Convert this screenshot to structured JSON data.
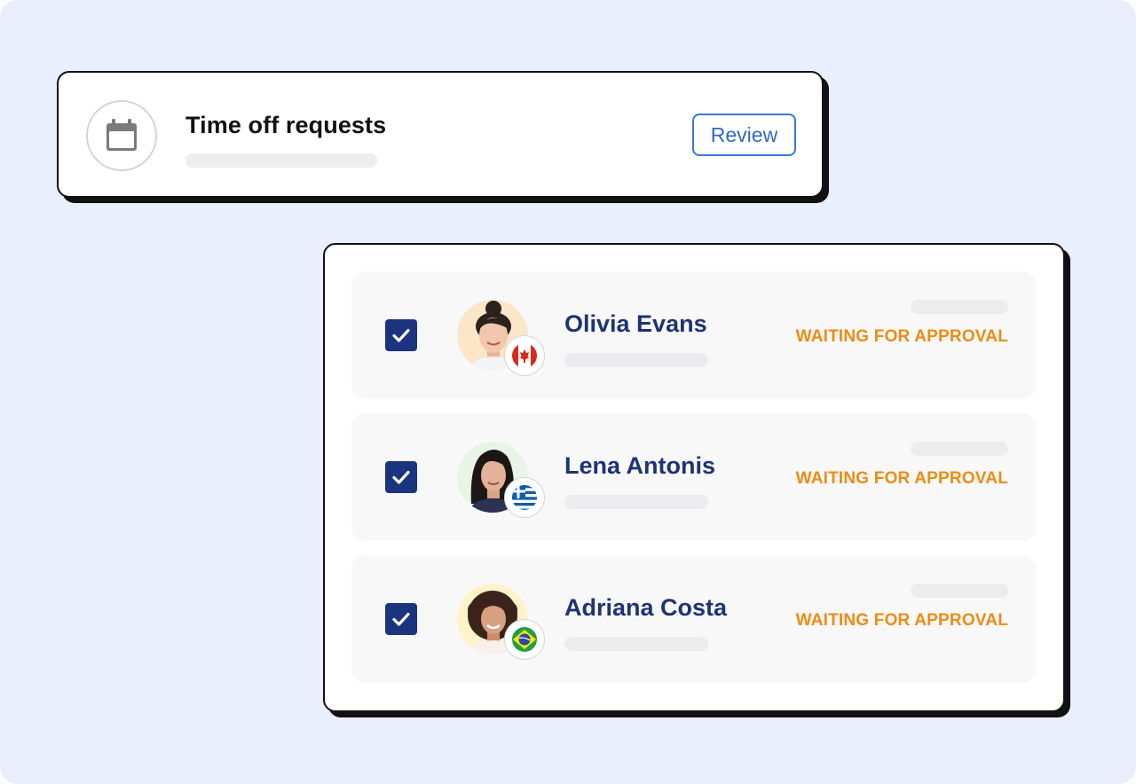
{
  "colors": {
    "background": "#e9effc",
    "accent_blue": "#3d76d6",
    "checkbox": "#1b3480",
    "name_text": "#1d3373",
    "status_orange": "#ee8b12"
  },
  "header_card": {
    "icon": "calendar-icon",
    "title": "Time off requests",
    "review_label": "Review"
  },
  "requests": [
    {
      "name": "Olivia Evans",
      "status": "WAITING FOR APPROVAL",
      "checked": true,
      "flag": "canada-flag-icon",
      "avatar": "avatar-photo"
    },
    {
      "name": "Lena Antonis",
      "status": "WAITING FOR APPROVAL",
      "checked": true,
      "flag": "greece-flag-icon",
      "avatar": "avatar-photo"
    },
    {
      "name": "Adriana Costa",
      "status": "WAITING FOR APPROVAL",
      "checked": true,
      "flag": "brazil-flag-icon",
      "avatar": "avatar-photo"
    }
  ]
}
